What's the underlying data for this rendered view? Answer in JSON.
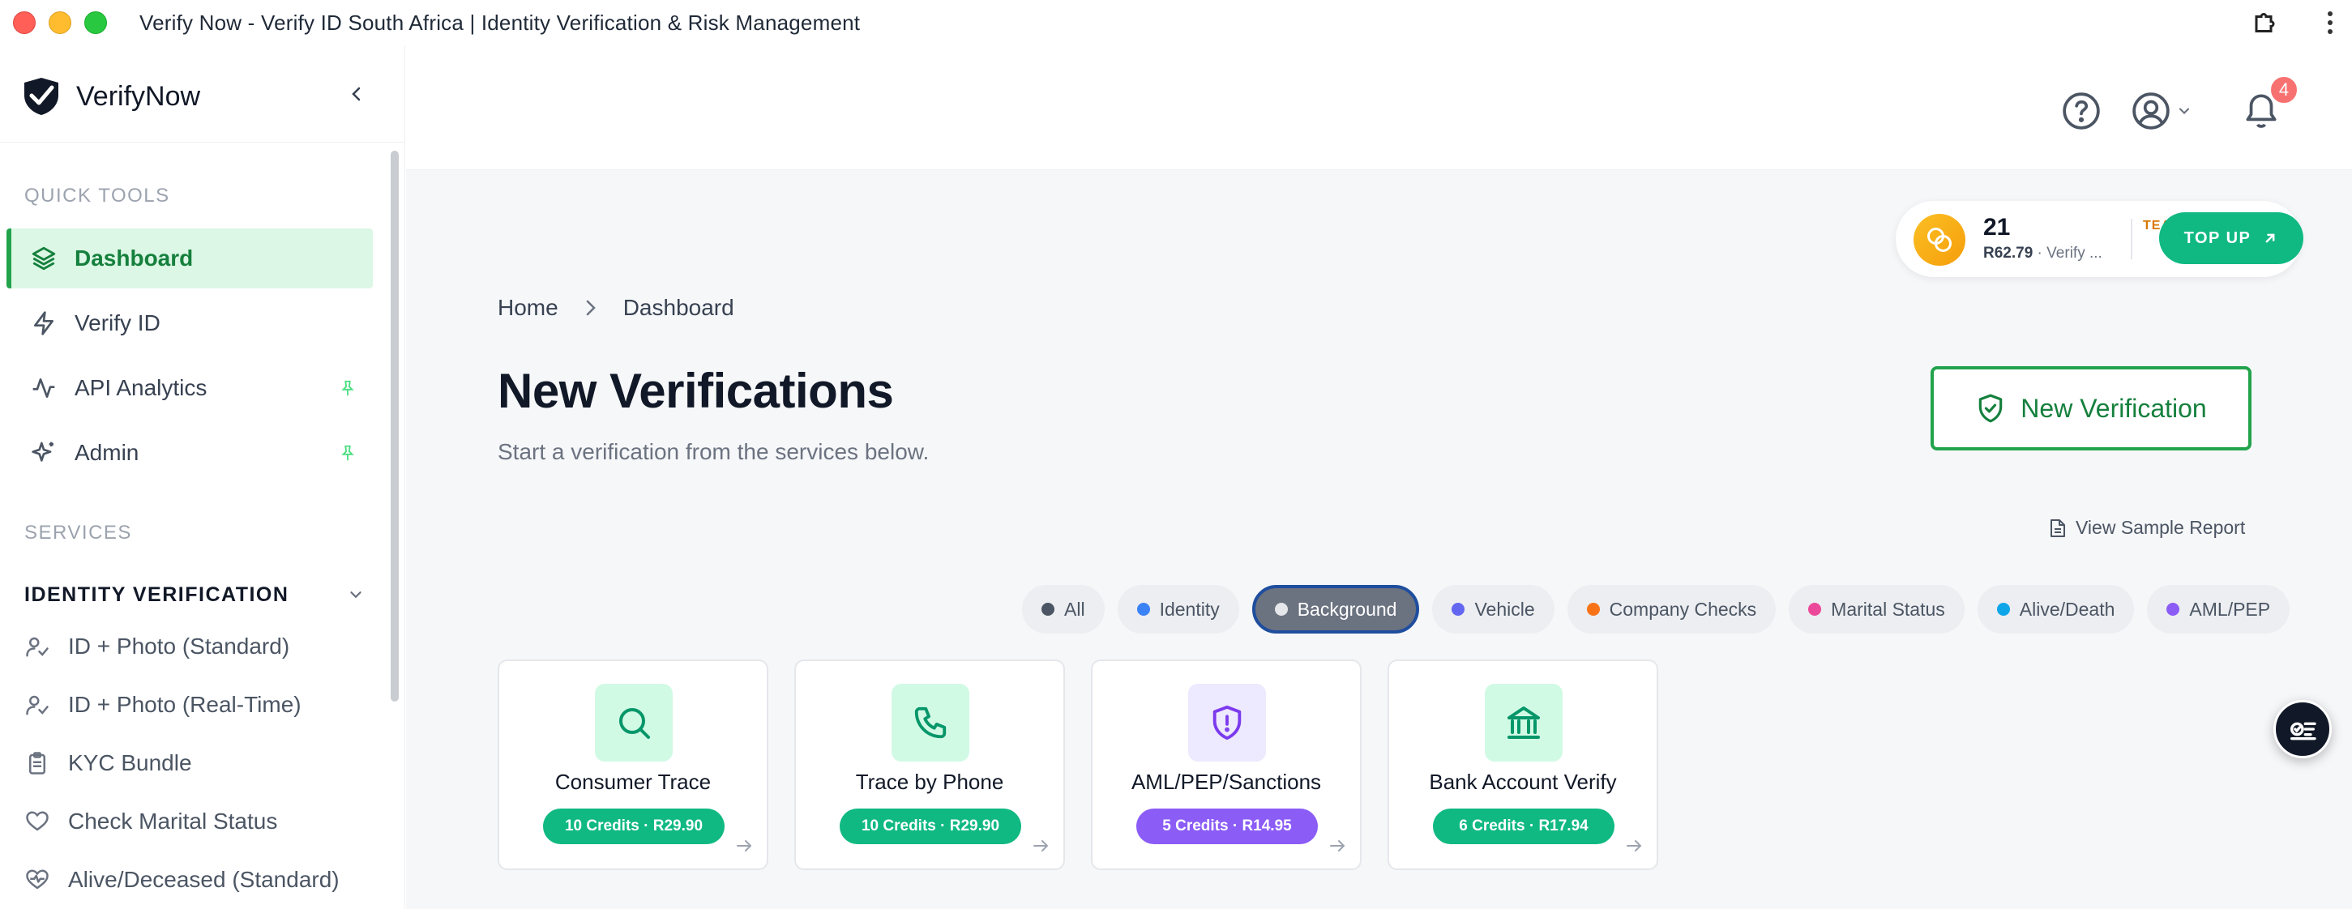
{
  "window": {
    "title": "Verify Now - Verify ID South Africa | Identity Verification & Risk Management"
  },
  "brand": {
    "name": "VerifyNow"
  },
  "sidebar": {
    "quick_tools_label": "QUICK TOOLS",
    "quick_tools": [
      {
        "label": "Dashboard",
        "icon": "layers-icon",
        "active": true
      },
      {
        "label": "Verify ID",
        "icon": "lightning-icon"
      },
      {
        "label": "API Analytics",
        "icon": "activity-icon",
        "pinned": true
      },
      {
        "label": "Admin",
        "icon": "sparkles-icon",
        "pinned": true
      }
    ],
    "services_label": "SERVICES",
    "group": {
      "label": "IDENTITY VERIFICATION"
    },
    "services": [
      {
        "label": "ID + Photo (Standard)",
        "icon": "user-check-icon"
      },
      {
        "label": "ID + Photo (Real-Time)",
        "icon": "user-check-icon"
      },
      {
        "label": "KYC Bundle",
        "icon": "clipboard-icon"
      },
      {
        "label": "Check Marital Status",
        "icon": "heart-icon"
      },
      {
        "label": "Alive/Deceased (Standard)",
        "icon": "heart-pulse-icon"
      }
    ]
  },
  "header": {
    "notifications_count": "4"
  },
  "credits": {
    "count": "21",
    "amount": "R62.79",
    "plan": "Verify ...",
    "team_label": "TEAM",
    "topup_label": "TOP UP"
  },
  "breadcrumb": {
    "home": "Home",
    "current": "Dashboard"
  },
  "page": {
    "title": "New Verifications",
    "subtitle": "Start a verification from the services below.",
    "new_button": "New Verification",
    "sample_report": "View Sample Report"
  },
  "filters": [
    {
      "label": "All",
      "color": "#4b5563"
    },
    {
      "label": "Identity",
      "color": "#3b82f6"
    },
    {
      "label": "Background",
      "color": "#9ca3af",
      "active": true
    },
    {
      "label": "Vehicle",
      "color": "#6366f1"
    },
    {
      "label": "Company Checks",
      "color": "#f97316"
    },
    {
      "label": "Marital Status",
      "color": "#ec4899"
    },
    {
      "label": "Alive/Death",
      "color": "#0ea5e9"
    },
    {
      "label": "AML/PEP",
      "color": "#8b5cf6"
    }
  ],
  "cards": [
    {
      "title": "Consumer Trace",
      "badge": "10 Credits · R29.90",
      "icon": "search-icon",
      "badge_color": "#10b981",
      "icon_bg": "#d1fae5",
      "icon_color": "#059669"
    },
    {
      "title": "Trace by Phone",
      "badge": "10 Credits · R29.90",
      "icon": "phone-icon",
      "badge_color": "#10b981",
      "icon_bg": "#d1fae5",
      "icon_color": "#059669"
    },
    {
      "title": "AML/PEP/Sanctions",
      "badge": "5 Credits · R14.95",
      "icon": "shield-alert-icon",
      "badge_color": "#8b5cf6",
      "icon_bg": "#ede9fe",
      "icon_color": "#7c3aed"
    },
    {
      "title": "Bank Account Verify",
      "badge": "6 Credits · R17.94",
      "icon": "bank-icon",
      "badge_color": "#10b981",
      "icon_bg": "#d1fae5",
      "icon_color": "#059669"
    }
  ]
}
